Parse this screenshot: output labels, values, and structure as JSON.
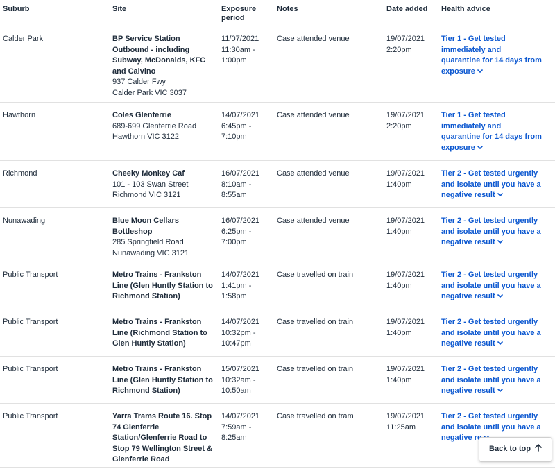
{
  "headers": {
    "suburb": "Suburb",
    "site": "Site",
    "exposure_1": "Exposure",
    "exposure_2": "period",
    "notes": "Notes",
    "date_added": "Date added",
    "health_advice": "Health advice"
  },
  "rows": [
    {
      "suburb": "Calder Park",
      "site_name": [
        "BP Service Station",
        "Outbound - including",
        "Subway, McDonalds, KFC",
        "and Calvino"
      ],
      "site_address": [
        "937 Calder Fwy",
        "Calder Park VIC 3037"
      ],
      "exposure": [
        "11/07/2021",
        "11:30am -",
        "1:00pm"
      ],
      "notes": "Case attended venue",
      "date_added": [
        "19/07/2021",
        "2:20pm"
      ],
      "advice": [
        "Tier 1 - Get tested",
        "immediately and",
        "quarantine for 14 days from",
        "exposure"
      ]
    },
    {
      "suburb": "Hawthorn",
      "site_name": [
        "Coles Glenferrie"
      ],
      "site_address": [
        "689-699 Glenferrie Road",
        "Hawthorn VIC 3122"
      ],
      "exposure": [
        "14/07/2021",
        "6:45pm -",
        "7:10pm"
      ],
      "notes": "Case attended venue",
      "date_added": [
        "19/07/2021",
        "2:20pm"
      ],
      "advice": [
        "Tier 1 - Get tested",
        "immediately and",
        "quarantine for 14 days from",
        "exposure"
      ]
    },
    {
      "suburb": "Richmond",
      "site_name": [
        "Cheeky Monkey Caf"
      ],
      "site_address": [
        "101 - 103 Swan Street",
        "Richmond VIC 3121"
      ],
      "exposure": [
        "16/07/2021",
        "8:10am -",
        "8:55am"
      ],
      "notes": "Case attended venue",
      "date_added": [
        "19/07/2021",
        "1:40pm"
      ],
      "advice": [
        "Tier 2 - Get tested urgently",
        "and isolate until you have a",
        "negative result"
      ]
    },
    {
      "suburb": "Nunawading",
      "site_name": [
        "Blue Moon Cellars",
        "Bottleshop"
      ],
      "site_address": [
        "285 Springfield Road",
        "Nunawading VIC 3121"
      ],
      "exposure": [
        "16/07/2021",
        "6:25pm -",
        "7:00pm"
      ],
      "notes": "Case attended venue",
      "date_added": [
        "19/07/2021",
        "1:40pm"
      ],
      "advice": [
        "Tier 2 - Get tested urgently",
        "and isolate until you have a",
        "negative result"
      ]
    },
    {
      "suburb": "Public Transport",
      "site_name": [
        "Metro Trains - Frankston",
        "Line (Glen Huntly Station to",
        "Richmond Station)"
      ],
      "site_address": [],
      "exposure": [
        "14/07/2021",
        "1:41pm -",
        "1:58pm"
      ],
      "notes": "Case travelled on train",
      "date_added": [
        "19/07/2021",
        "1:40pm"
      ],
      "advice": [
        "Tier 2 - Get tested urgently",
        "and isolate until you have a",
        "negative result"
      ]
    },
    {
      "suburb": "Public Transport",
      "site_name": [
        "Metro Trains - Frankston",
        "Line (Richmond Station to",
        "Glen Huntly Station)"
      ],
      "site_address": [],
      "exposure": [
        "14/07/2021",
        "10:32pm -",
        "10:47pm"
      ],
      "notes": "Case travelled on train",
      "date_added": [
        "19/07/2021",
        "1:40pm"
      ],
      "advice": [
        "Tier 2 - Get tested urgently",
        "and isolate until you have a",
        "negative result"
      ]
    },
    {
      "suburb": "Public Transport",
      "site_name": [
        "Metro Trains - Frankston",
        "Line (Glen Huntly Station to",
        "Richmond Station)"
      ],
      "site_address": [],
      "exposure": [
        "15/07/2021",
        "10:32am -",
        "10:50am"
      ],
      "notes": "Case travelled on train",
      "date_added": [
        "19/07/2021",
        "1:40pm"
      ],
      "advice": [
        "Tier 2 - Get tested urgently",
        "and isolate until you have a",
        "negative result"
      ]
    },
    {
      "suburb": "Public Transport",
      "site_name": [
        "Yarra Trams Route 16. Stop",
        "74 Glenferrie",
        "Station/Glenferrie Road to",
        "Stop 79 Wellington Street &",
        "Glenferrie Road"
      ],
      "site_address": [],
      "exposure": [
        "14/07/2021",
        "7:59am -",
        "8:25am"
      ],
      "notes": "Case travelled on tram",
      "date_added": [
        "19/07/2021",
        "11:25am"
      ],
      "advice": [
        "Tier 2 - Get tested urgently",
        "and isolate until you have a",
        "negative re"
      ]
    }
  ],
  "back_to_top": {
    "label": "Back to top",
    "icon": "arrow-up-icon"
  },
  "colors": {
    "advice_link": "#0b57d0",
    "text": "#1e2b3a",
    "row_border": "#e1e1e1"
  }
}
